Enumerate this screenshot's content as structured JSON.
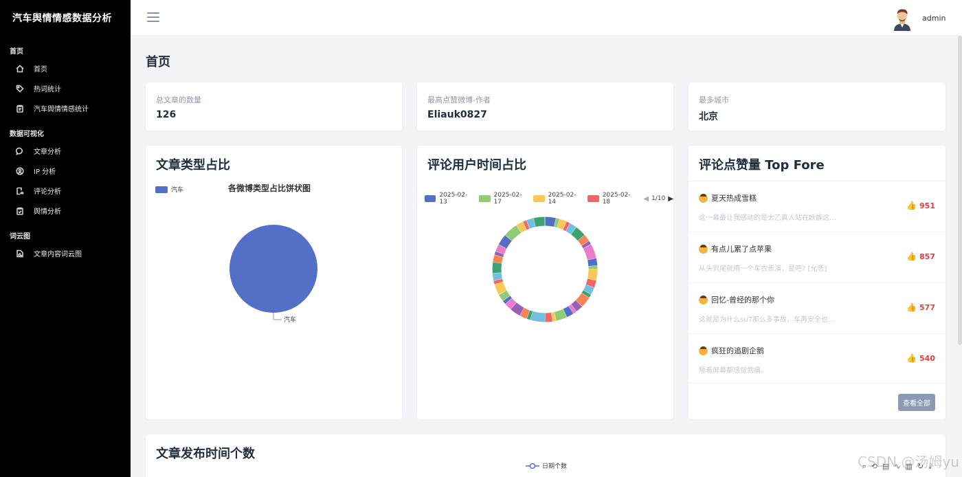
{
  "app": {
    "title": "汽车舆情情感数据分析"
  },
  "sidebar": {
    "sections": [
      {
        "label": "首页",
        "items": [
          {
            "label": "首页",
            "icon": "home-icon"
          },
          {
            "label": "热词统计",
            "icon": "tag-icon"
          },
          {
            "label": "汽车舆情情感统计",
            "icon": "clipboard-icon"
          }
        ]
      },
      {
        "label": "数据可视化",
        "items": [
          {
            "label": "文章分析",
            "icon": "chat-icon"
          },
          {
            "label": "IP 分析",
            "icon": "user-circle-icon"
          },
          {
            "label": "评论分析",
            "icon": "chart-doc-icon"
          },
          {
            "label": "舆情分析",
            "icon": "clipboard-check-icon"
          }
        ]
      },
      {
        "label": "词云图",
        "items": [
          {
            "label": "文章内容词云图",
            "icon": "file-chart-icon"
          }
        ]
      }
    ]
  },
  "header": {
    "user": "admin"
  },
  "page": {
    "title": "首页"
  },
  "stats": [
    {
      "label": "总文章的数量",
      "value": "126"
    },
    {
      "label": "最高点赞微博-作者",
      "value": "Eliauk0827"
    },
    {
      "label": "最多城市",
      "value": "北京"
    }
  ],
  "article_type": {
    "title": "文章类型占比",
    "chart_data": {
      "type": "pie",
      "title": "各微博类型占比饼状图",
      "categories": [
        "汽车"
      ],
      "values": [
        100
      ],
      "colors": [
        "#5470c6"
      ]
    }
  },
  "comment_time": {
    "title": "评论用户时间占比",
    "legend_page": "1/10",
    "chart_data": {
      "type": "pie",
      "legend": [
        "2025-02-13",
        "2025-02-17",
        "2025-02-14",
        "2025-02-18"
      ],
      "colors": [
        "#5470c6",
        "#91cc75",
        "#fac858",
        "#ee6666"
      ]
    }
  },
  "top_comments": {
    "title": "评论点赞量 Top Fore",
    "items": [
      {
        "name": "夏天热成雪糕",
        "text": "这一幕最让我感动的是太乙真人站在妖族这…",
        "likes": "951"
      },
      {
        "name": "有点儿累了点苹果",
        "text": "从头到尾就用一个车衣表演，是吧? [允悲]",
        "likes": "857"
      },
      {
        "name": "回忆-曾经的那个你",
        "text": "这就是为什么su7那么多事故，车再安全也…",
        "likes": "577"
      },
      {
        "name": "疯狂的追剧企鹅",
        "text": "隔着屏幕都感觉到痛。",
        "likes": "540"
      }
    ],
    "view_all": "查看全部"
  },
  "publish_time": {
    "title": "文章发布时间个数",
    "chart_data": {
      "type": "line",
      "legend": [
        "日期个数"
      ]
    }
  },
  "watermark": "CSDN @汤姆yu"
}
